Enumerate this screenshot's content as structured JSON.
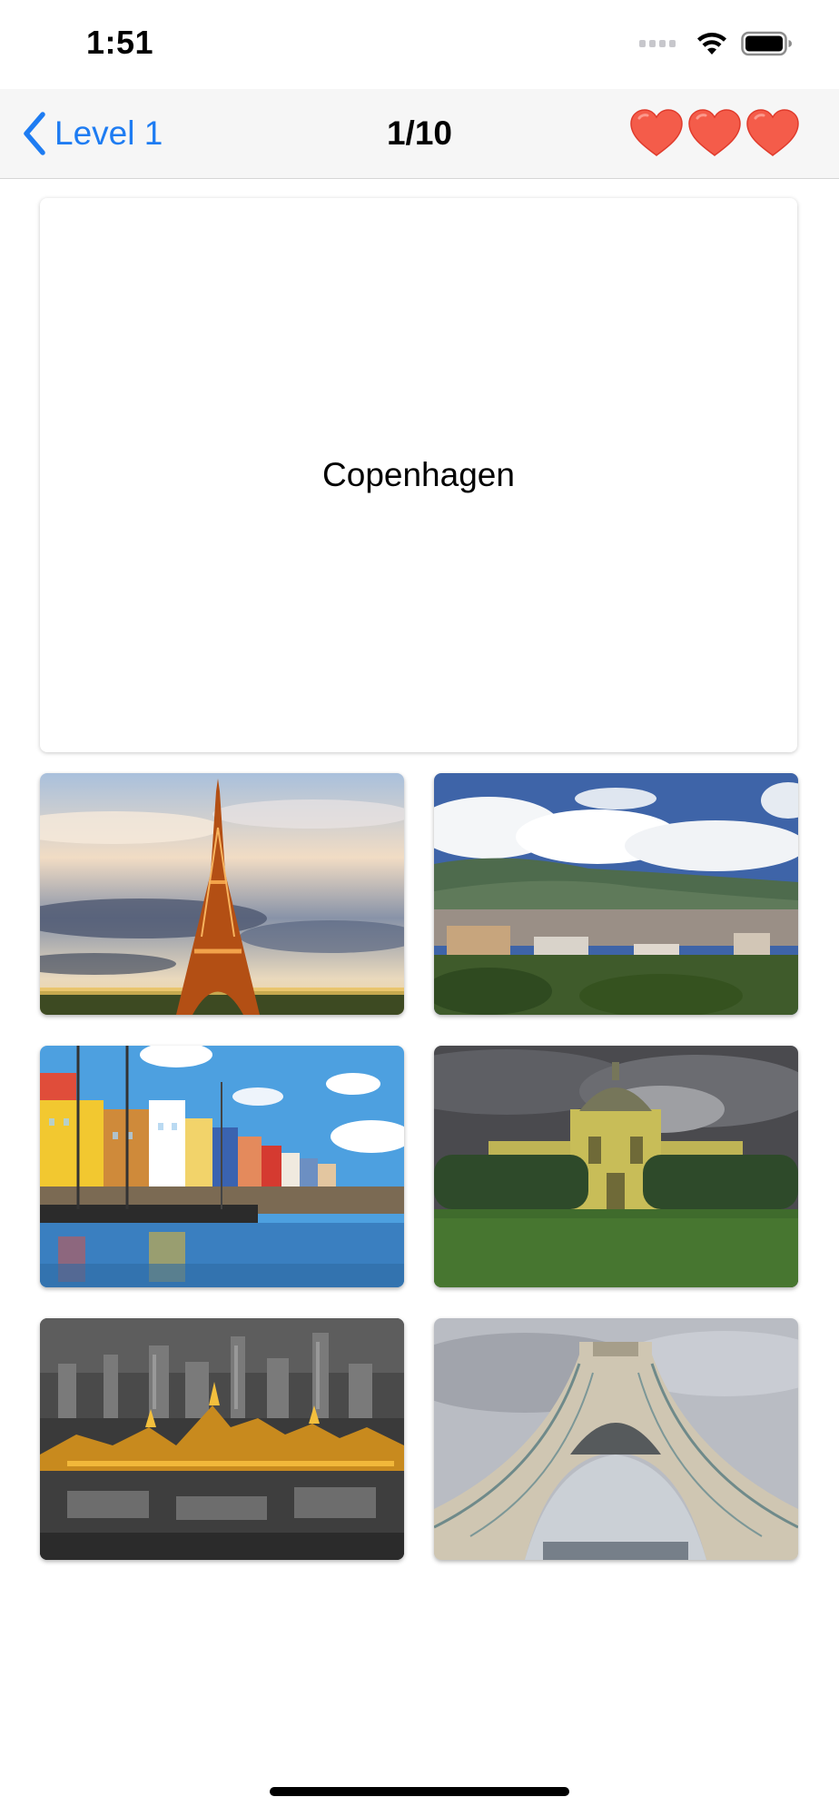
{
  "status_bar": {
    "time": "1:51",
    "icons": [
      "cellular-signal-icon",
      "wifi-icon",
      "battery-icon"
    ]
  },
  "nav": {
    "back_label": "Level 1",
    "progress": "1/10",
    "lives_total": 3,
    "lives_remaining": 3,
    "heart_color": "#f45c4a",
    "back_color": "#1e7cf2"
  },
  "question": {
    "city": "Copenhagen"
  },
  "options": [
    {
      "icon": "eiffel-tower-photo"
    },
    {
      "icon": "mountain-city-photo"
    },
    {
      "icon": "nyhavn-harbor-photo"
    },
    {
      "icon": "yellow-palace-photo"
    },
    {
      "icon": "night-temple-skyline-photo"
    },
    {
      "icon": "azadi-tower-photo"
    }
  ]
}
